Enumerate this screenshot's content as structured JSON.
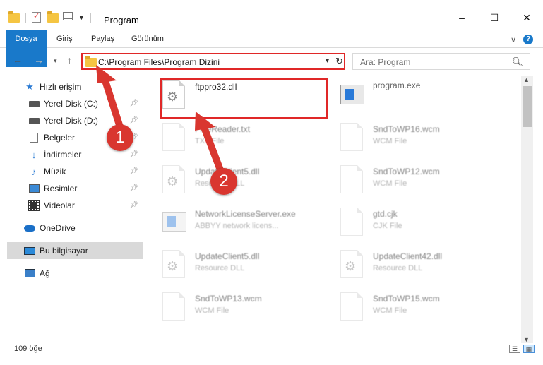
{
  "window": {
    "title": "Program",
    "controls": {
      "minimize": "–",
      "maximize": "☐",
      "close": "✕"
    }
  },
  "ribbon": {
    "tabs": [
      {
        "label": "Dosya"
      },
      {
        "label": "Giriş"
      },
      {
        "label": "Paylaş"
      },
      {
        "label": "Görünüm"
      }
    ],
    "collapse_icon": "chevron-down-icon",
    "help_label": "?"
  },
  "navigation": {
    "back": "←",
    "forward": "→",
    "recent": "▾",
    "up": "↑",
    "address_path": "C:\\Program Files\\Program Dizini",
    "address_dropdown": "▾",
    "refresh": "↻",
    "search_placeholder": "Ara: Program",
    "search_icon": "⚲"
  },
  "sidebar": {
    "items": [
      {
        "label": "Hızlı erişim",
        "icon": "star-icon",
        "pinned": false
      },
      {
        "label": "Yerel Disk (C:)",
        "icon": "drive-icon",
        "pinned": true
      },
      {
        "label": "Yerel Disk (D:)",
        "icon": "drive-icon",
        "pinned": true
      },
      {
        "label": "Belgeler",
        "icon": "documents-icon",
        "pinned": true
      },
      {
        "label": "İndirmeler",
        "icon": "download-icon",
        "pinned": true
      },
      {
        "label": "Müzik",
        "icon": "music-icon",
        "pinned": true
      },
      {
        "label": "Resimler",
        "icon": "pictures-icon",
        "pinned": true
      },
      {
        "label": "Videolar",
        "icon": "videos-icon",
        "pinned": true
      },
      {
        "label": "OneDrive",
        "icon": "cloud-icon",
        "pinned": false
      },
      {
        "label": "Bu bilgisayar",
        "icon": "computer-icon",
        "pinned": false,
        "selected": true
      },
      {
        "label": "Ağ",
        "icon": "network-icon",
        "pinned": false
      }
    ],
    "pin_glyph": "📌"
  },
  "files": [
    {
      "name": "ftppro32.dll",
      "type": "",
      "icon": "dll-gear-icon",
      "highlighted": true
    },
    {
      "name": "program.exe",
      "type": "",
      "icon": "exe-icon",
      "highlighted": false
    },
    {
      "name": "FineReader.txt",
      "type": "TXT File",
      "icon": "text-file-icon",
      "highlighted": false
    },
    {
      "name": "SndToWP16.wcm",
      "type": "WCM File",
      "icon": "blank-file-icon",
      "highlighted": false
    },
    {
      "name": "UpdateClient5.dll",
      "type": "Resource DLL",
      "icon": "dll-gear-icon",
      "highlighted": false
    },
    {
      "name": "SndToWP12.wcm",
      "type": "WCM File",
      "icon": "blank-file-icon",
      "highlighted": false
    },
    {
      "name": "NetworkLicenseServer.exe",
      "type": "ABBYY network licens...",
      "icon": "exe-icon",
      "highlighted": false
    },
    {
      "name": "gtd.cjk",
      "type": "CJK File",
      "icon": "blank-file-icon",
      "highlighted": false
    },
    {
      "name": "UpdateClient5.dll",
      "type": "Resource DLL",
      "icon": "dll-gear-icon",
      "highlighted": false
    },
    {
      "name": "UpdateClient42.dll",
      "type": "Resource DLL",
      "icon": "dll-gear-icon",
      "highlighted": false
    },
    {
      "name": "SndToWP13.wcm",
      "type": "WCM File",
      "icon": "blank-file-icon",
      "highlighted": false
    },
    {
      "name": "SndToWP15.wcm",
      "type": "WCM File",
      "icon": "blank-file-icon",
      "highlighted": false
    }
  ],
  "status": {
    "item_count": "109 öğe",
    "view_details": "☰",
    "view_icons": "▦"
  },
  "annotations": {
    "step1": "1",
    "step2": "2",
    "color": "#d9362f"
  },
  "colors": {
    "accent": "#1979ca",
    "highlight_border": "#e02828",
    "selected_bg": "#d9d9d9"
  }
}
